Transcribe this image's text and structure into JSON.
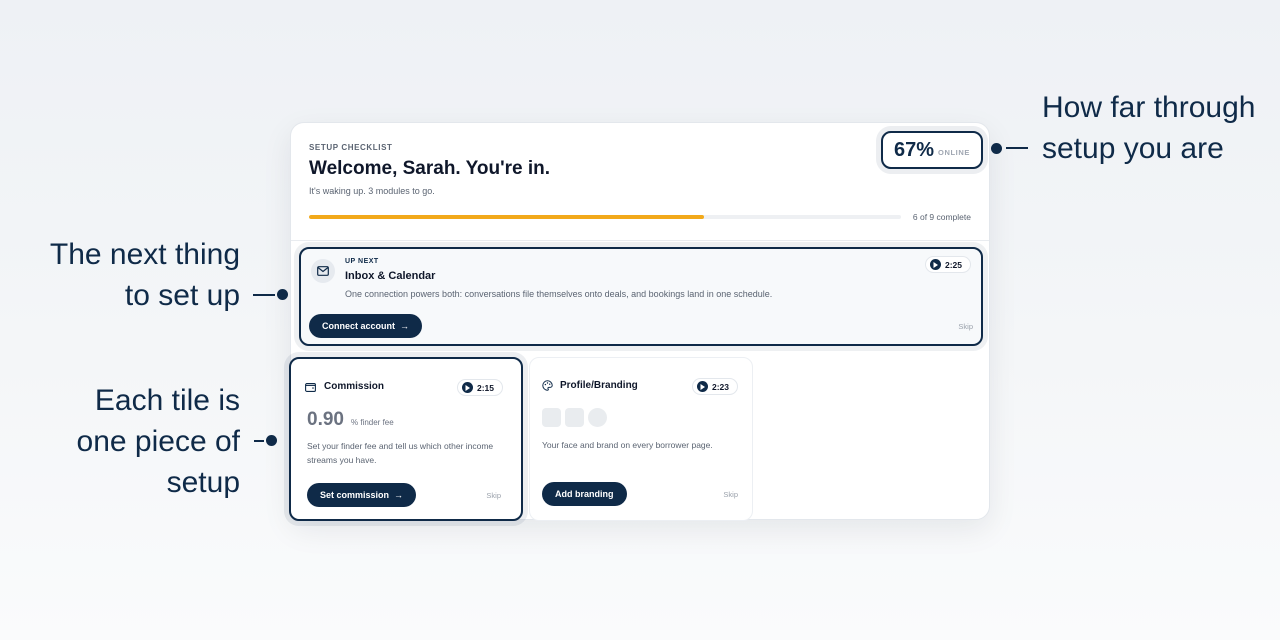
{
  "checklist": {
    "eyebrow": "SETUP CHECKLIST",
    "title": "Welcome, Sarah. You're in.",
    "subtitle": "It's waking up. 3 modules to go.",
    "progress_fraction": 0.667,
    "progress_label": "6 of 9 complete",
    "percent": "67%",
    "status": "ONLINE",
    "accent_color": "#f2a91a",
    "brand_color": "#0f2a48"
  },
  "up_next": {
    "eyebrow": "UP NEXT",
    "title": "Inbox & Calendar",
    "description": "One connection powers both: conversations file themselves onto deals, and bookings land in one schedule.",
    "duration": "2:25",
    "button_label": "Connect account",
    "skip_label": "Skip",
    "icon": "mail-icon"
  },
  "tiles": [
    {
      "title": "Commission",
      "icon": "wallet-icon",
      "duration": "2:15",
      "value": "0.90",
      "unit": "% finder fee",
      "description": "Set your finder fee and tell us which other income streams you have.",
      "button_label": "Set commission",
      "skip_label": "Skip"
    },
    {
      "title": "Profile/Branding",
      "icon": "palette-icon",
      "duration": "2:23",
      "description": "Your face and brand on every borrower page.",
      "button_label": "Add branding",
      "skip_label": "Skip"
    }
  ],
  "annotations": {
    "progress": "How far through setup you are",
    "next": "The next thing to set up",
    "tile": "Each tile is one piece of setup"
  }
}
